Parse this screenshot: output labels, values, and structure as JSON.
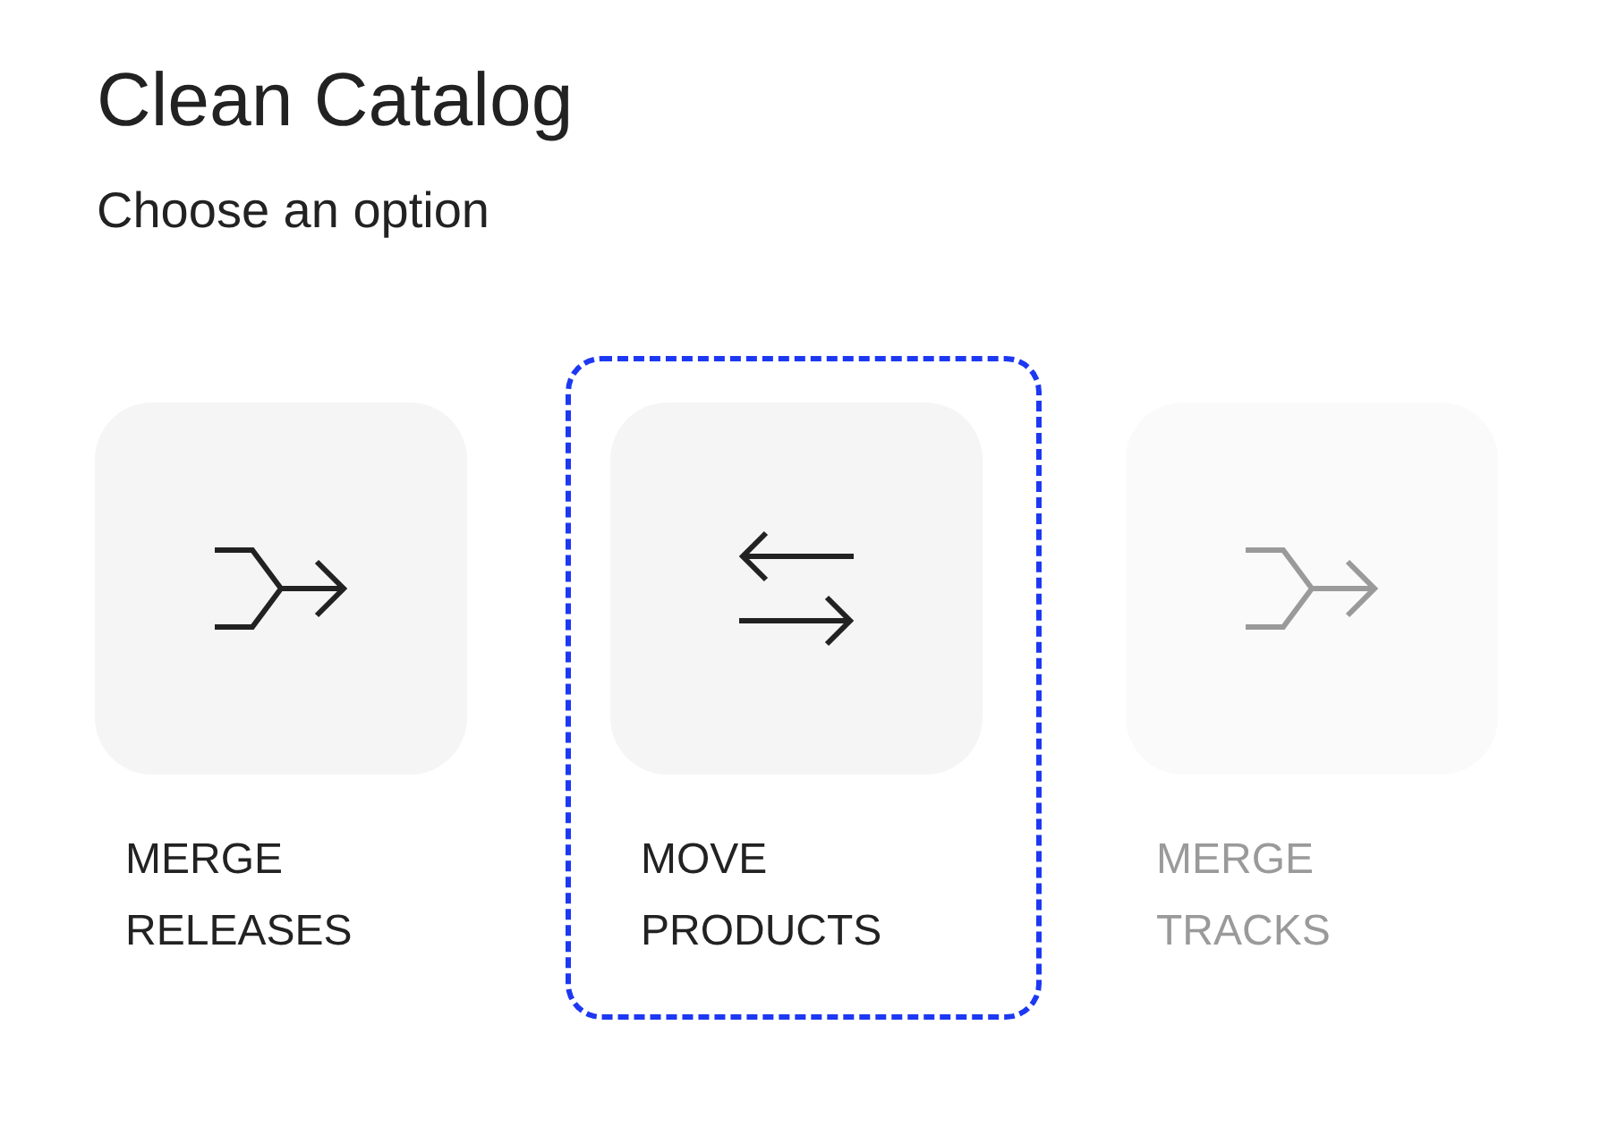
{
  "title": "Clean Catalog",
  "subtitle": "Choose an option",
  "options": [
    {
      "kind": "merge",
      "label": "MERGE RELEASES",
      "selected": false,
      "disabled": false
    },
    {
      "kind": "move",
      "label": "MOVE PRODUCTS",
      "selected": true,
      "disabled": false
    },
    {
      "kind": "merge",
      "label": "MERGE TRACKS",
      "selected": false,
      "disabled": true
    }
  ]
}
